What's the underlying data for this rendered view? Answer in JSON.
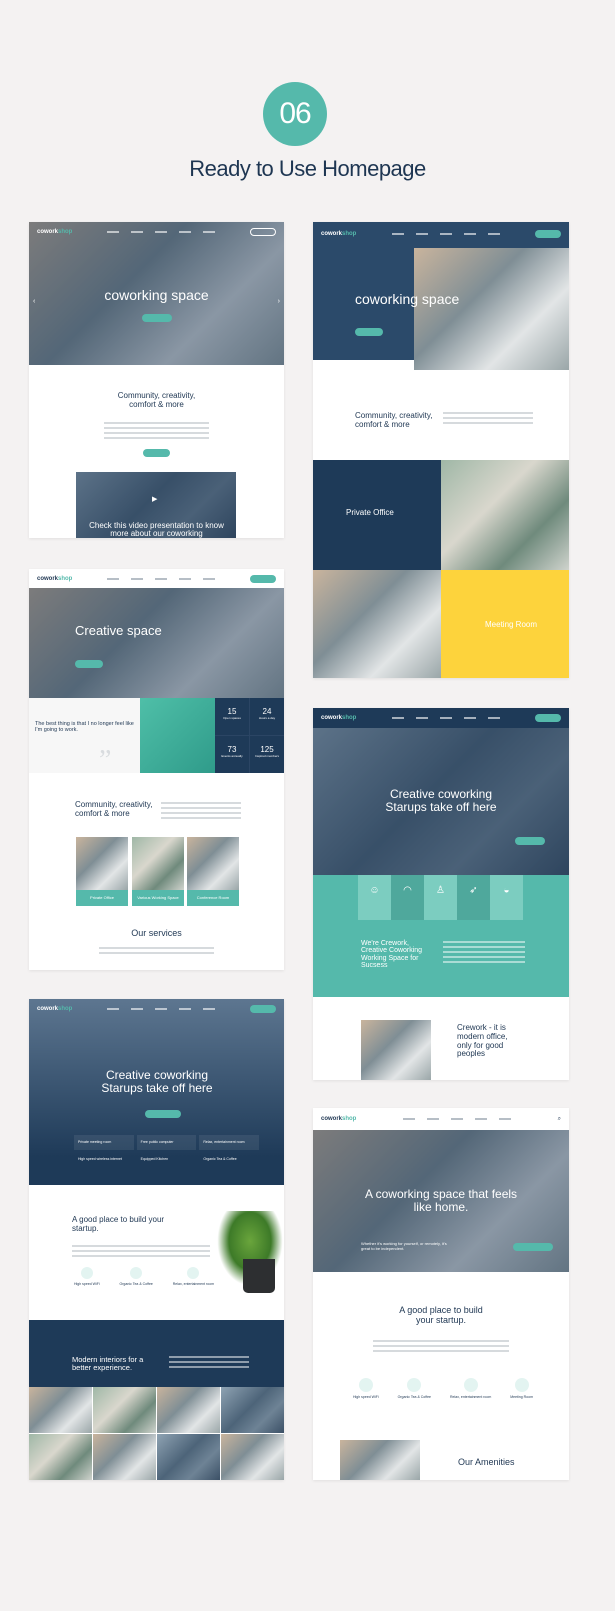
{
  "header": {
    "number": "06",
    "title": "Ready to Use Homepage"
  },
  "colors": {
    "accent": "#55b9ab",
    "navy": "#1e3652",
    "yellow": "#fdd33c",
    "background": "#f4f2f2"
  },
  "brand": {
    "logo_part1": "cowork",
    "logo_part2": "shop"
  },
  "homepages": {
    "h1": {
      "hero_title": "coworking space",
      "section_title": "Community, creativity, comfort & more",
      "video_caption": "Check this video presentation to know more about our coworking"
    },
    "h2": {
      "hero_title": "coworking space",
      "section_title": "Community, creativity, comfort & more",
      "tile_office": "Private Office",
      "tile_meeting": "Meeting Room"
    },
    "h3": {
      "hero_title": "Creative space",
      "quote": "The best thing is that I no longer feel like I'm going to work.",
      "stats": [
        {
          "value": "15",
          "label": "Open spaces"
        },
        {
          "value": "24",
          "label": "Hours a day"
        },
        {
          "value": "73",
          "label": "Events annually"
        },
        {
          "value": "125",
          "label": "Inspired members"
        }
      ],
      "section_title": "Community, creativity, comfort & more",
      "cards": [
        "Private Office",
        "Various Working Space",
        "Conference Room"
      ],
      "services_title": "Our services"
    },
    "h4": {
      "hero_title": "Creative coworking Starups take off here",
      "band_title": "We're Crework, Creative Coworking Working Space for Sucsess",
      "section_title": "Crework - it is modern office, only for good peoples"
    },
    "h5": {
      "hero_title": "Creative coworking Starups take off here",
      "features": [
        "Private meeting room",
        "Free public computer",
        "Relax, entertainment room",
        "High speed wireless internet",
        "Equipped Kitchen",
        "Organic Tea & Coffee"
      ],
      "section_title": "A good place to build your startup.",
      "amenities": [
        "High speed WiFi",
        "Organic Tea & Coffee",
        "Relax, entertainment room"
      ],
      "band_title": "Modern interiors for a better experience."
    },
    "h6": {
      "hero_title": "A coworking space that feels like home.",
      "hero_sub": "Whether it's working for yourself, or remotely, it's great to be independent.",
      "section_title": "A good place to build your startup.",
      "amenities": [
        "High speed WiFi",
        "Organic Tea & Coffee",
        "Relax, entertainment room",
        "Meeting Room"
      ],
      "amenities_title": "Our Amenities"
    }
  }
}
